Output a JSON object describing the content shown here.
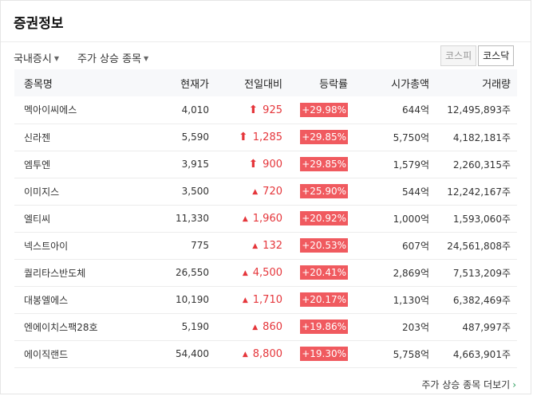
{
  "title": "증권정보",
  "filters": {
    "market": "국내증시",
    "category": "주가 상승 종목"
  },
  "market_tabs": [
    {
      "label": "코스피",
      "active": false
    },
    {
      "label": "코스닥",
      "active": true
    }
  ],
  "table": {
    "headers": {
      "name": "종목명",
      "price": "현재가",
      "change": "전일대비",
      "rate": "등락률",
      "market_cap": "시가총액",
      "volume": "거래량"
    },
    "rows": [
      {
        "name": "멕아이씨에스",
        "price": "4,010",
        "change": "925",
        "rate": "+29.98%",
        "market_cap": "644억",
        "volume": "12,495,893주",
        "icon": "upper-limit-arrow-icon"
      },
      {
        "name": "신라젠",
        "price": "5,590",
        "change": "1,285",
        "rate": "+29.85%",
        "market_cap": "5,750억",
        "volume": "4,182,181주",
        "icon": "upper-limit-arrow-icon"
      },
      {
        "name": "엠투엔",
        "price": "3,915",
        "change": "900",
        "rate": "+29.85%",
        "market_cap": "1,579억",
        "volume": "2,260,315주",
        "icon": "upper-limit-arrow-icon"
      },
      {
        "name": "이미지스",
        "price": "3,500",
        "change": "720",
        "rate": "+25.90%",
        "market_cap": "544억",
        "volume": "12,242,167주",
        "icon": "rise-triangle-icon"
      },
      {
        "name": "엘티씨",
        "price": "11,330",
        "change": "1,960",
        "rate": "+20.92%",
        "market_cap": "1,000억",
        "volume": "1,593,060주",
        "icon": "rise-triangle-icon"
      },
      {
        "name": "넥스트아이",
        "price": "775",
        "change": "132",
        "rate": "+20.53%",
        "market_cap": "607억",
        "volume": "24,561,808주",
        "icon": "rise-triangle-icon"
      },
      {
        "name": "퀄리타스반도체",
        "price": "26,550",
        "change": "4,500",
        "rate": "+20.41%",
        "market_cap": "2,869억",
        "volume": "7,513,209주",
        "icon": "rise-triangle-icon"
      },
      {
        "name": "대봉엘에스",
        "price": "10,190",
        "change": "1,710",
        "rate": "+20.17%",
        "market_cap": "1,130억",
        "volume": "6,382,469주",
        "icon": "rise-triangle-icon"
      },
      {
        "name": "엔에이치스팩28호",
        "price": "5,190",
        "change": "860",
        "rate": "+19.86%",
        "market_cap": "203억",
        "volume": "487,997주",
        "icon": "rise-triangle-icon"
      },
      {
        "name": "에이직랜드",
        "price": "54,400",
        "change": "8,800",
        "rate": "+19.30%",
        "market_cap": "5,758억",
        "volume": "4,663,901주",
        "icon": "rise-triangle-icon"
      }
    ]
  },
  "more_link": "주가 상승 종목 더보기",
  "colors": {
    "rise": "#e5363b",
    "rate_badge": "#f05a5f",
    "more_chevron": "#2a9d5c"
  }
}
